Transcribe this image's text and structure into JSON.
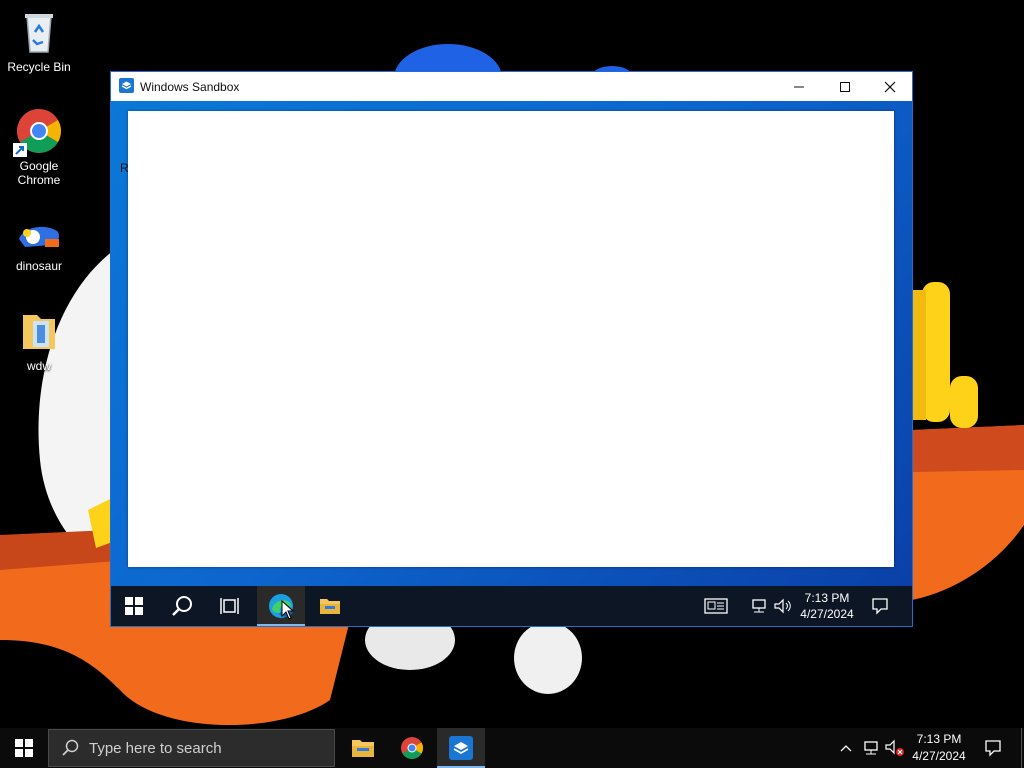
{
  "desktop": {
    "icons": [
      {
        "label": "Recycle Bin",
        "icon": "recycle-bin-icon"
      },
      {
        "label": "Google\nChrome",
        "icon": "chrome-icon"
      },
      {
        "label": "dinosaur",
        "icon": "dinosaur-icon"
      },
      {
        "label": "wdw",
        "icon": "folder-icon"
      }
    ]
  },
  "sandbox_window": {
    "title": "Windows Sandbox",
    "inner_fragment": "R",
    "taskbar": {
      "clock_time": "7:13 PM",
      "clock_date": "4/27/2024"
    }
  },
  "taskbar": {
    "search_placeholder": "Type here to search",
    "clock_time": "7:13 PM",
    "clock_date": "4/27/2024"
  },
  "colors": {
    "accent": "#0a78d6",
    "taskbar_bg": "#0b0b0b",
    "wallpaper_orange": "#f26b1d",
    "wallpaper_blue": "#1f6fe0",
    "wallpaper_yellow": "#ffd21a"
  }
}
